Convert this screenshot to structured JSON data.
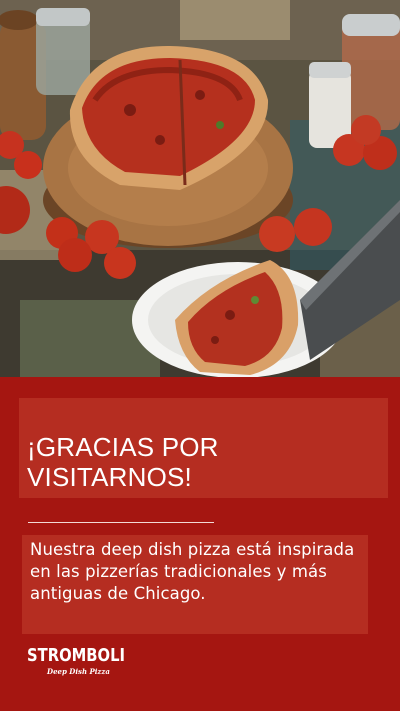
{
  "photo": {
    "icon": "deep-dish-pizza-photo"
  },
  "headline": {
    "text": "¡GRACIAS POR VISITARNOS!"
  },
  "description": {
    "text": "Nuestra deep dish pizza está inspirada en las pizzerías tradicionales y más antiguas de Chicago."
  },
  "logo": {
    "name": "STROMBOLI",
    "tagline": "Deep Dish Pizza"
  },
  "colors": {
    "background": "#a51611",
    "panel": "#b52d21",
    "text": "#ffffff"
  }
}
